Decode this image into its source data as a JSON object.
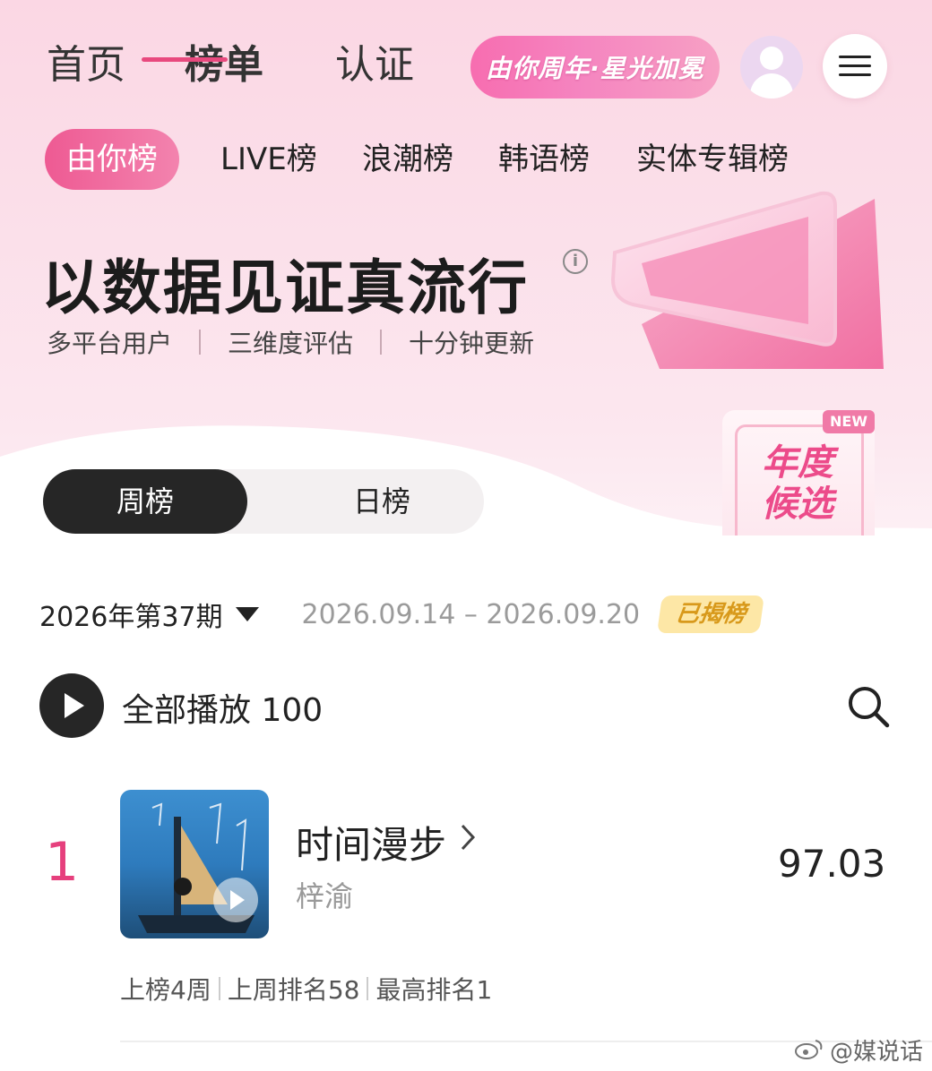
{
  "topnav": {
    "home": "首页",
    "chart": "榜单",
    "cert": "认证",
    "promo": "由你周年·星光加冕"
  },
  "subtabs": [
    "由你榜",
    "LIVE榜",
    "浪潮榜",
    "韩语榜",
    "实体专辑榜"
  ],
  "hero": {
    "headline": "以数据见证真流行",
    "info": "i",
    "features": [
      "多平台用户",
      "三维度评估",
      "十分钟更新"
    ]
  },
  "toggle": {
    "week": "周榜",
    "day": "日榜",
    "active": "周榜"
  },
  "annual": {
    "line1": "年度",
    "line2": "候选",
    "badge": "NEW"
  },
  "period": {
    "label": "2026年第37期",
    "range": "2026.09.14 – 2026.09.20",
    "status": "已揭榜"
  },
  "play_all": {
    "label": "全部播放 100"
  },
  "tracks": [
    {
      "rank": "1",
      "title": "时间漫步",
      "artist": "梓渝",
      "score": "97.03",
      "stats": [
        "上榜4周",
        "上周排名58",
        "最高排名1"
      ]
    }
  ],
  "watermark": "@媒说话",
  "colors": {
    "accent": "#e8497e",
    "badge_bg": "#fde7a6",
    "badge_text": "#d8991b"
  },
  "icons": {
    "menu": "hamburger-icon",
    "avatar": "user-avatar-icon",
    "search": "search-icon",
    "play": "play-icon",
    "info": "info-icon"
  }
}
